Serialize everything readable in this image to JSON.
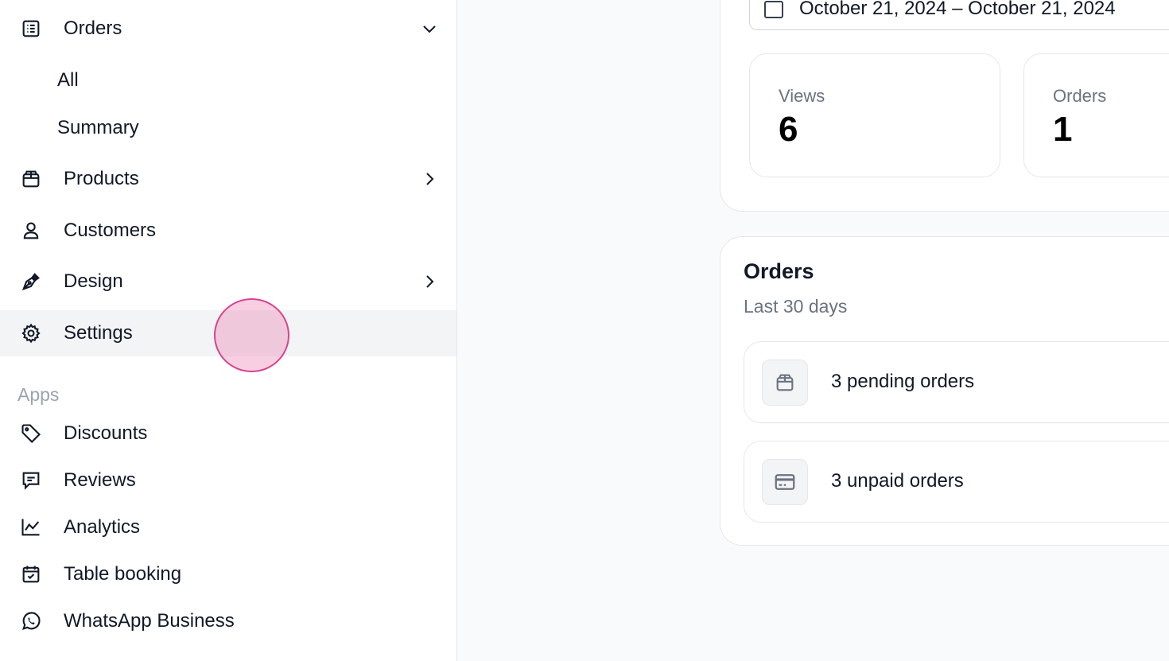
{
  "sidebar": {
    "orders": {
      "label": "Orders",
      "sub": [
        "All",
        "Summary"
      ]
    },
    "products": {
      "label": "Products"
    },
    "customers": {
      "label": "Customers"
    },
    "design": {
      "label": "Design"
    },
    "settings": {
      "label": "Settings"
    },
    "apps_heading": "Apps",
    "apps": [
      {
        "label": "Discounts",
        "icon": "tag-icon"
      },
      {
        "label": "Reviews",
        "icon": "message-icon"
      },
      {
        "label": "Analytics",
        "icon": "chart-icon"
      },
      {
        "label": "Table booking",
        "icon": "calendar-icon"
      },
      {
        "label": "WhatsApp Business",
        "icon": "whatsapp-icon"
      }
    ]
  },
  "main": {
    "date_range": "October 21, 2024 – October 21, 2024",
    "stats": [
      {
        "label": "Views",
        "value": "6"
      },
      {
        "label": "Orders",
        "value": "1"
      }
    ],
    "orders_card": {
      "title": "Orders",
      "subtitle": "Last 30 days",
      "rows": [
        {
          "text": "3 pending orders",
          "icon": "package-icon"
        },
        {
          "text": "3 unpaid orders",
          "icon": "credit-card-icon"
        }
      ]
    }
  },
  "colors": {
    "active_bg": "#f3f4f6",
    "cursor": "#d9438e"
  }
}
